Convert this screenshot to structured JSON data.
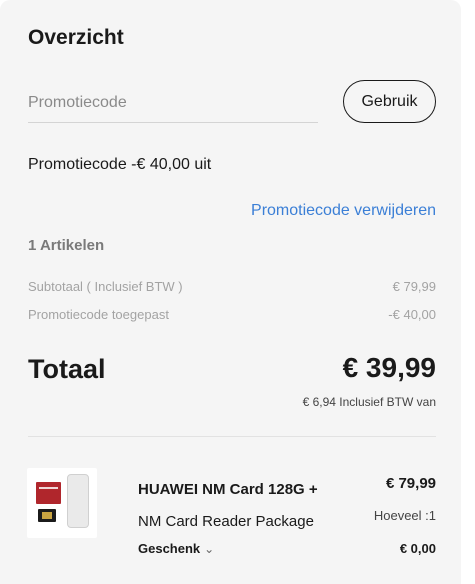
{
  "summary": {
    "title": "Overzicht",
    "promo_placeholder": "Promotiecode",
    "apply_label": "Gebruik",
    "applied_text": "Promotiecode -€ 40,00 uit",
    "remove_label": "Promotiecode verwijderen",
    "item_count": "1 Artikelen",
    "subtotal_label": "Subtotaal ( Inclusief BTW )",
    "subtotal_value": "€ 79,99",
    "promo_applied_label": "Promotiecode toegepast",
    "promo_applied_value": "-€ 40,00",
    "total_label": "Totaal",
    "total_value": "€ 39,99",
    "vat_note": "€ 6,94 Inclusief BTW van"
  },
  "product": {
    "name_line1": "HUAWEI NM Card 128G +",
    "name_line2": "NM Card Reader Package",
    "price": "€ 79,99",
    "quantity": "Hoeveel :1",
    "gift_label": "Geschenk",
    "gift_price": "€ 0,00",
    "image_icon": "nm-card-with-reader-image"
  },
  "colors": {
    "panel_bg": "#f5f5f5",
    "link": "#3b7fd6",
    "muted": "#a3a3a3"
  }
}
